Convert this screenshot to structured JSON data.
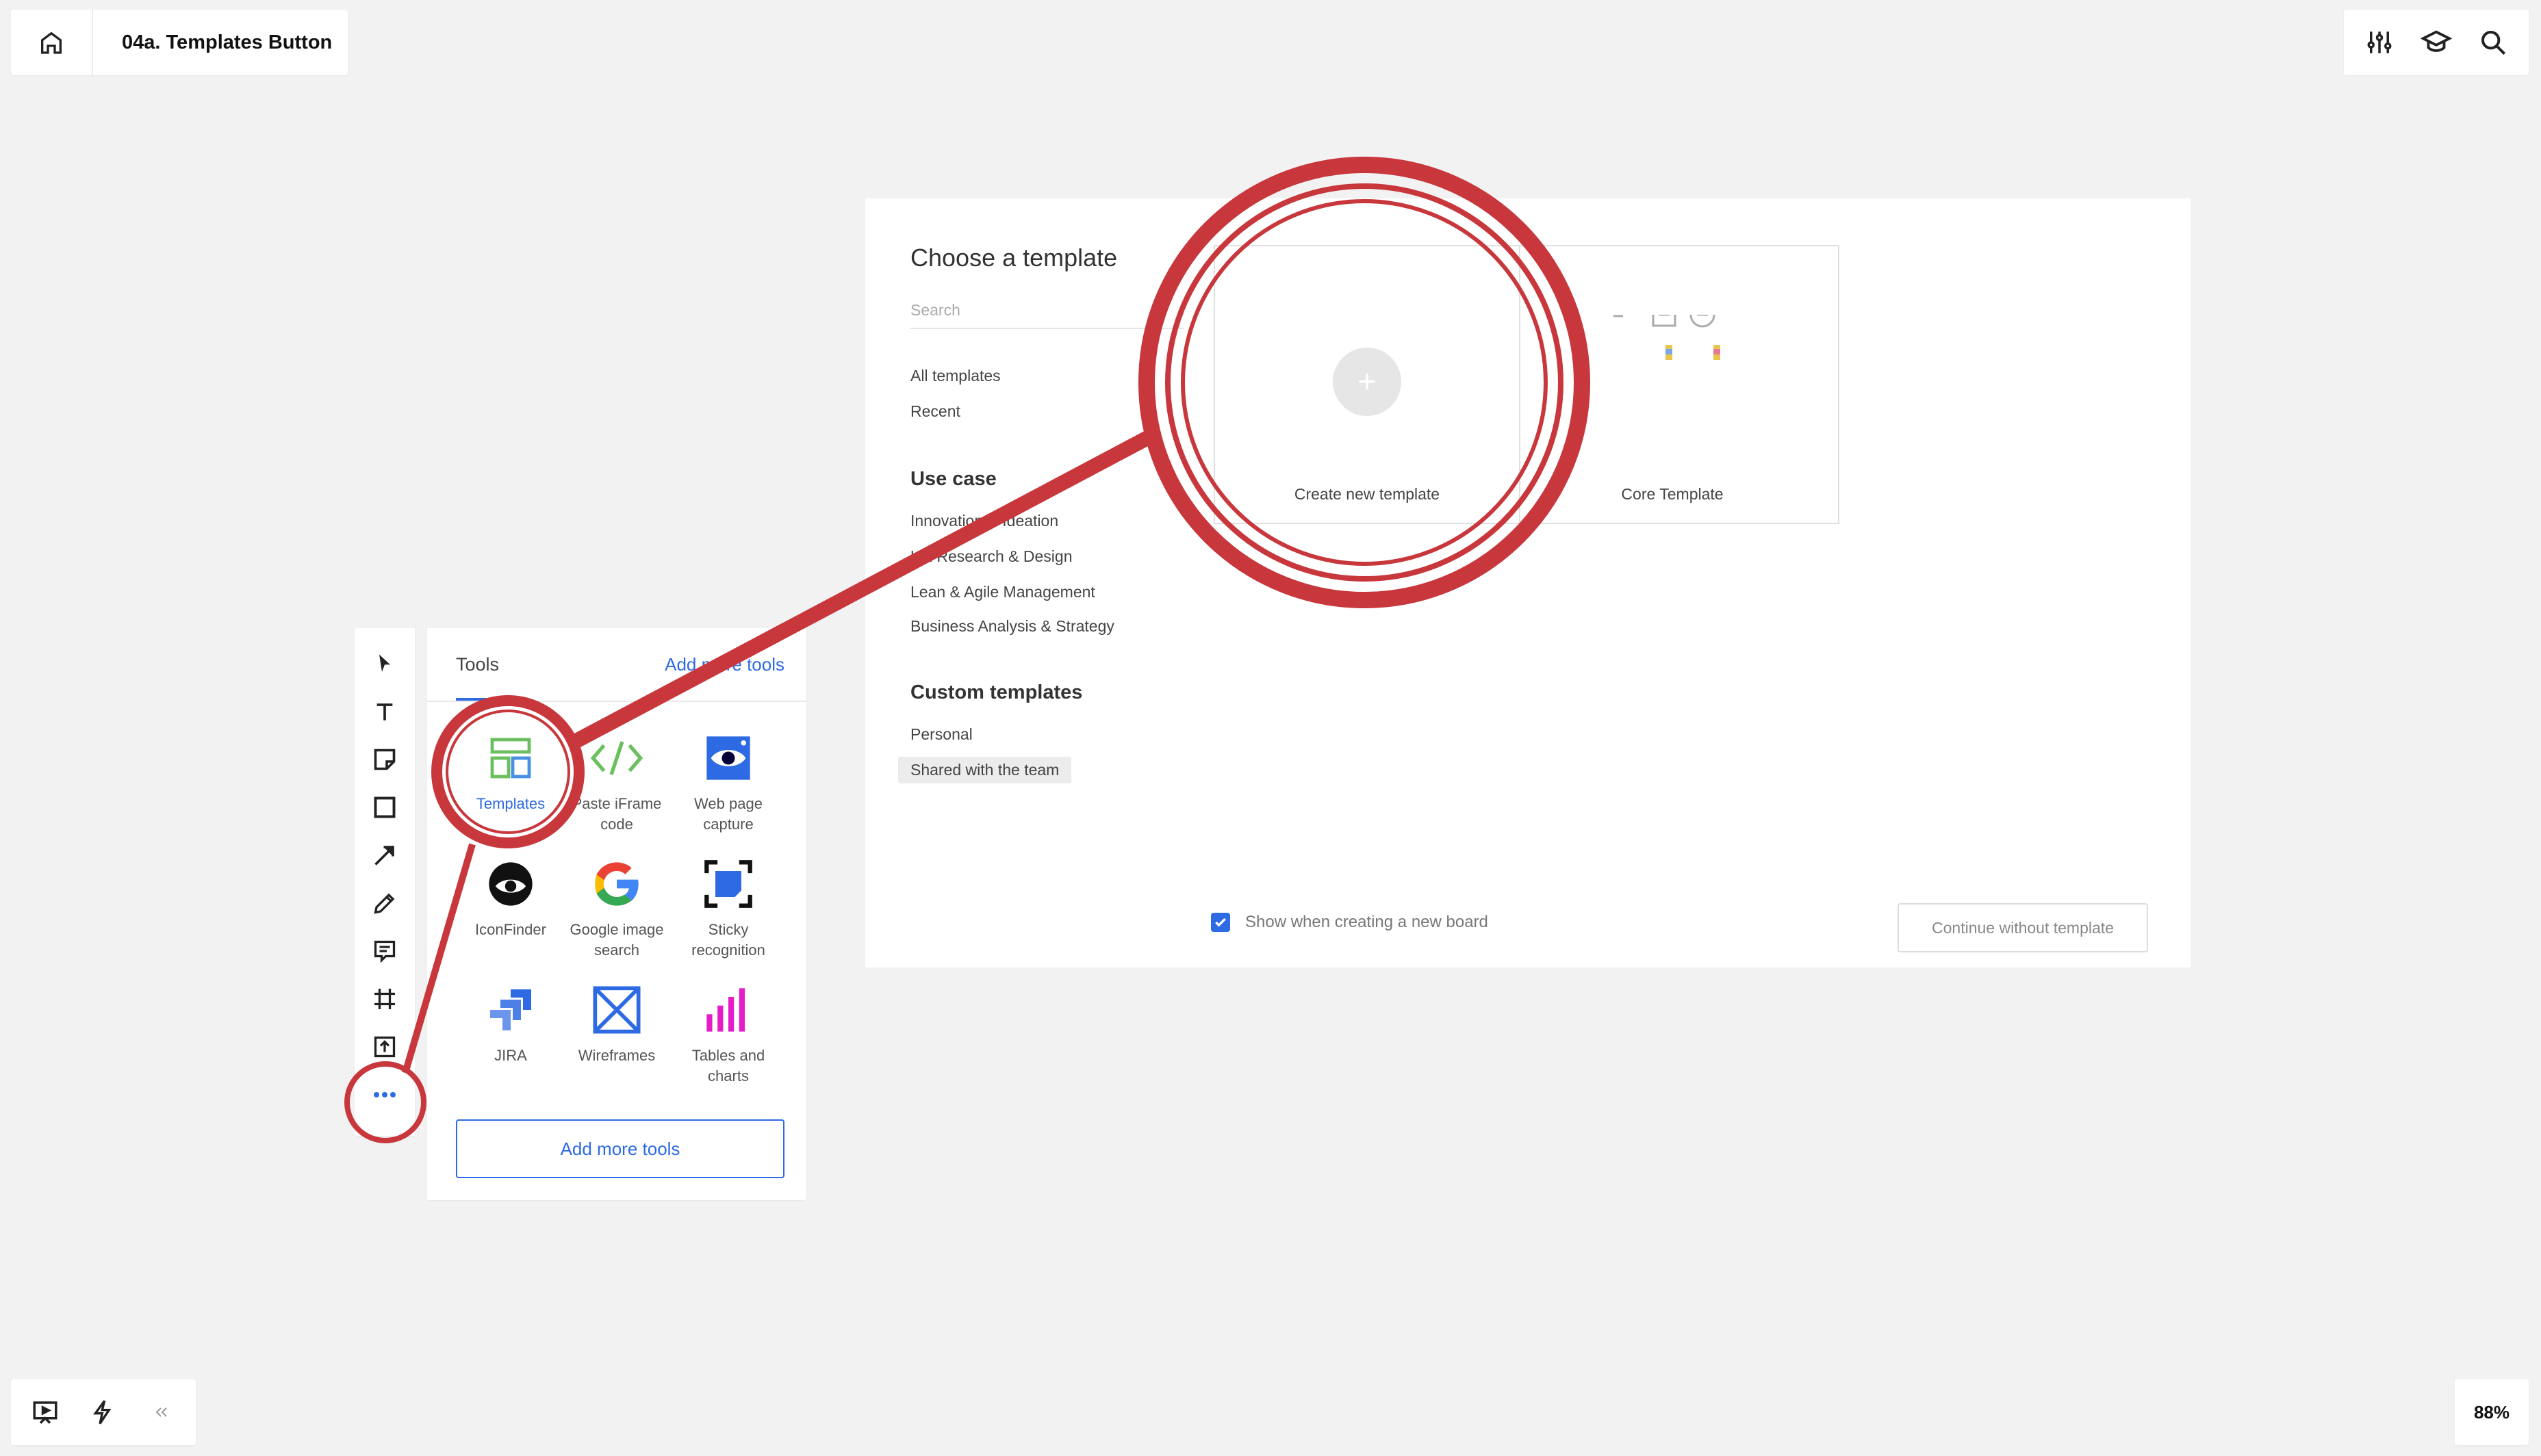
{
  "header": {
    "board_title": "04a. Templates Button"
  },
  "zoom": {
    "level": "88%"
  },
  "template_modal": {
    "title": "Choose a template",
    "search_placeholder": "Search",
    "nav": [
      "All templates",
      "Recent"
    ],
    "use_case_title": "Use case",
    "use_cases": [
      "Innovation & Ideation",
      "UX Research & Design",
      "Lean & Agile Management",
      "Business Analysis & Strategy"
    ],
    "custom_title": "Custom templates",
    "custom": [
      "Personal",
      "Shared with the team"
    ],
    "cards": [
      {
        "label": "Create new template"
      },
      {
        "label": "Core Template"
      }
    ],
    "checkbox_label": "Show when creating a new board",
    "checkbox_checked": true,
    "continue_label": "Continue without template"
  },
  "tools_panel": {
    "tab_label": "Tools",
    "add_more_link": "Add more tools",
    "tools": [
      {
        "label": "Templates",
        "icon": "templates-icon",
        "active": true
      },
      {
        "label": "Paste iFrame code",
        "icon": "code-icon"
      },
      {
        "label": "Web page capture",
        "icon": "eye-icon"
      },
      {
        "label": "IconFinder",
        "icon": "iconfinder-icon"
      },
      {
        "label": "Google image search",
        "icon": "google-icon"
      },
      {
        "label": "Sticky recognition",
        "icon": "sticky-recognition-icon"
      },
      {
        "label": "JIRA",
        "icon": "jira-icon"
      },
      {
        "label": "Wireframes",
        "icon": "wireframes-icon"
      },
      {
        "label": "Tables and charts",
        "icon": "chart-icon"
      }
    ],
    "add_tools_button": "Add more tools"
  },
  "colors": {
    "accent": "#2d6ae3",
    "callout": "#c8373c",
    "templates_icon": "#6bbf5f"
  }
}
